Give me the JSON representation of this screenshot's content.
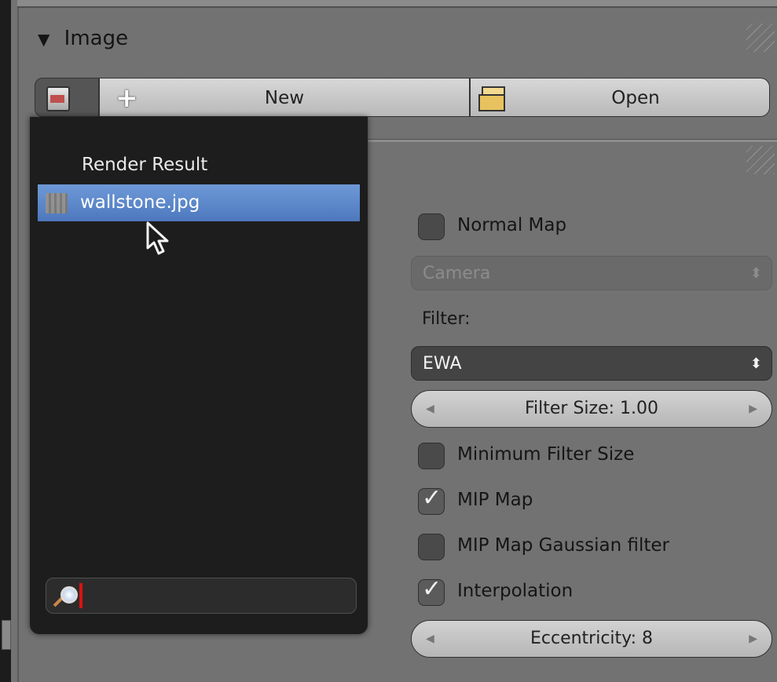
{
  "panel": {
    "title": "Image",
    "collapse_icon": "triangle-down-icon"
  },
  "toolbar": {
    "browse_icon": "image-browse-icon",
    "new_label": "New",
    "new_icon": "plus-icon",
    "open_label": "Open",
    "open_icon": "folder-open-icon"
  },
  "dropdown": {
    "items": [
      {
        "label": "Render Result",
        "selected": false
      },
      {
        "label": "wallstone.jpg",
        "selected": true,
        "icon": "image-thumbnail-icon"
      }
    ],
    "search": {
      "value": "",
      "icon": "magnifier-icon"
    }
  },
  "settings": {
    "normal_map": {
      "label": "Normal Map",
      "checked": false
    },
    "normal_space": {
      "value": "Camera",
      "enabled": false
    },
    "filter_label": "Filter:",
    "filter": {
      "value": "EWA"
    },
    "filter_size": {
      "text": "Filter Size: 1.00"
    },
    "minimum_filter_size": {
      "label": "Minimum Filter Size",
      "checked": false
    },
    "mip_map": {
      "label": "MIP Map",
      "checked": true
    },
    "mip_map_gaussian": {
      "label": "MIP Map Gaussian filter",
      "checked": false
    },
    "interpolation": {
      "label": "Interpolation",
      "checked": true
    },
    "eccentricity": {
      "text": "Eccentricity: 8"
    }
  }
}
